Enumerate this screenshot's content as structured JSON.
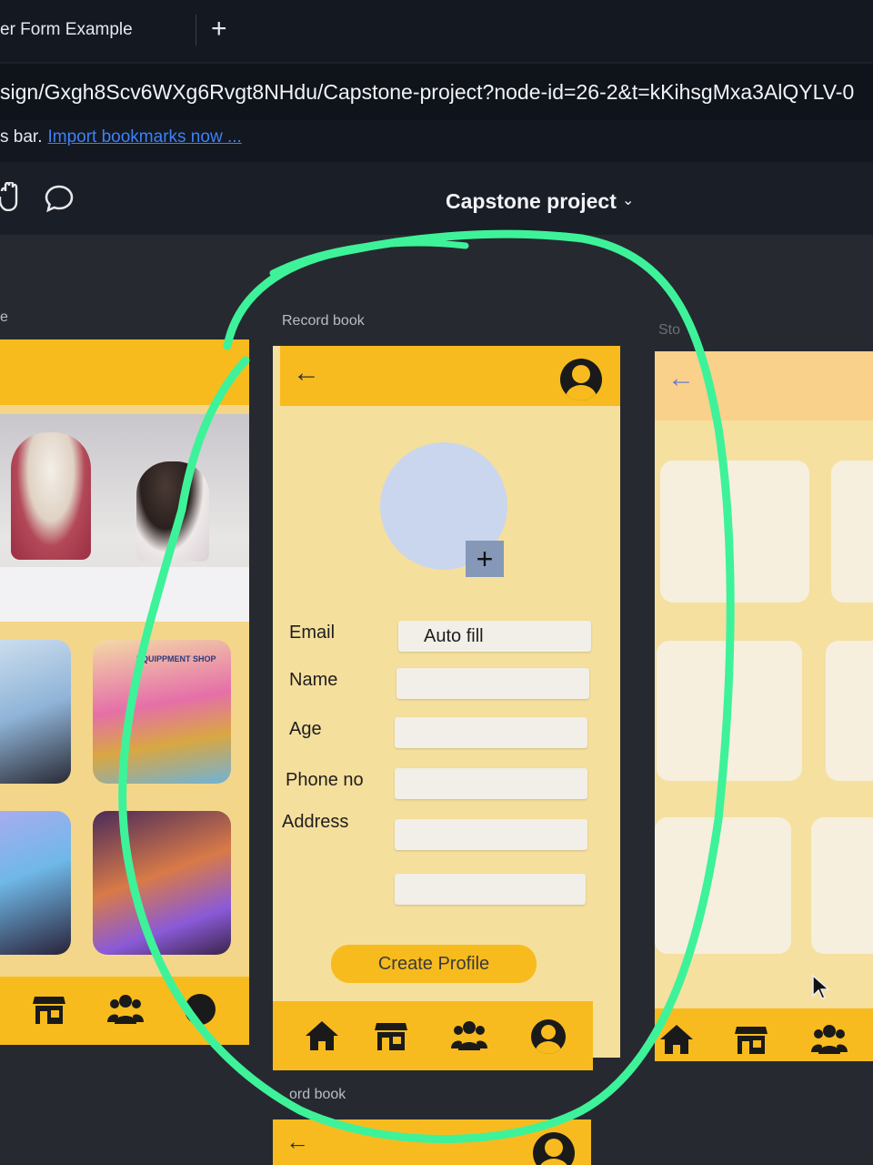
{
  "browser": {
    "tab_title": "er Form Example",
    "new_tab": "+",
    "url": "sign/Gxgh8Scv6WXg6Rvgt8NHdu/Capstone-project?node-id=26-2&t=kKihsgMxa3AlQYLV-0",
    "bookmarks_prefix": "s bar.",
    "bookmarks_link": "Import bookmarks now ..."
  },
  "figma": {
    "project_title": "Capstone project",
    "project_chevron": "⌄",
    "toolbar_icons": [
      "hand-icon",
      "comment-icon"
    ]
  },
  "frames": {
    "left_label": "e",
    "center_label": "Record book",
    "right_label": "Sto",
    "bottom_label": "ord book"
  },
  "form": {
    "back": "←",
    "photo_add": "+",
    "fields": [
      {
        "label": "Email",
        "value": "Auto fill"
      },
      {
        "label": "Name",
        "value": ""
      },
      {
        "label": "Age",
        "value": ""
      },
      {
        "label": "Phone no",
        "value": ""
      },
      {
        "label": "Address",
        "value": ""
      },
      {
        "label": "",
        "value": ""
      }
    ],
    "submit": "Create Profile"
  },
  "thumbs": {
    "equipment_sign": "EQUIPPMENT SHOP"
  },
  "colors": {
    "highlight": "#3ef29a",
    "header_yellow": "#f8bb1f",
    "form_bg": "#f5df9c"
  }
}
